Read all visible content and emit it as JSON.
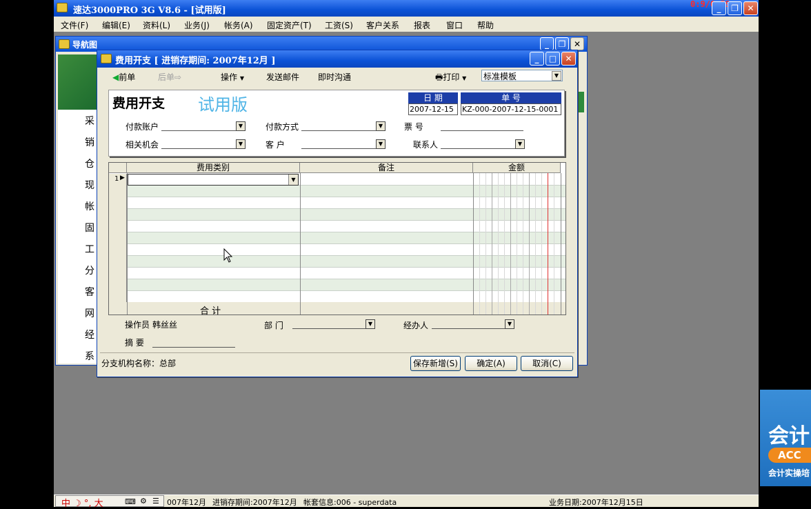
{
  "app": {
    "title": "速达3000PRO 3G V8.6 - [试用版]",
    "timer": "0:9/0:59"
  },
  "menu": [
    "文件(F)",
    "编辑(E)",
    "资料(L)",
    "业务(J)",
    "帐务(A)",
    "固定资产(T)",
    "工资(S)",
    "客户关系",
    "报表",
    "窗口",
    "帮助"
  ],
  "nav": {
    "title": "导航图",
    "items": [
      "采",
      "销",
      "仓",
      "现",
      "帐",
      "固",
      "工",
      "分",
      "客",
      "网",
      "经",
      "系"
    ]
  },
  "dialog": {
    "title": "费用开支 [ 进销存期间: 2007年12月 ]",
    "toolbar": {
      "prev": "前单",
      "next": "后单",
      "operate": "操作",
      "send_mail": "发送邮件",
      "chat": "即时沟通",
      "print": "打印",
      "template": "标准模板"
    },
    "form": {
      "heading": "费用开支",
      "trial": "试用版",
      "date_label": "日  期",
      "date_value": "2007-12-15",
      "no_label": "单  号",
      "no_value": "KZ-000-2007-12-15-0001",
      "pay_account_label": "付款账户",
      "pay_method_label": "付款方式",
      "ticket_label": "票    号",
      "opportunity_label": "相关机会",
      "customer_label": "客    户",
      "contact_label": "联系人"
    },
    "grid": {
      "columns": [
        "费用类别",
        "备注",
        "金额"
      ],
      "first_row_num": "1",
      "total_label": "合  计"
    },
    "footer": {
      "operator_label": "操作员",
      "operator_value": "韩丝丝",
      "dept_label": "部  门",
      "handler_label": "经办人",
      "summary_label": "摘  要",
      "branch": "分支机构名称：总部",
      "save_new": "保存新增(S)",
      "ok": "确定(A)",
      "cancel": "取消(C)"
    }
  },
  "statusbar": {
    "ime": "中 ☽ °, 大",
    "period1": "007年12月",
    "period2": "进销存期间:2007年12月",
    "account": "帐套信息:006 - superdata",
    "business_date": "业务日期:2007年12月15日"
  },
  "ad": {
    "big": "会计",
    "pill": "ACC",
    "small": "会计实操培"
  },
  "colors": {
    "titlebar": "#0b52d6",
    "trial_text": "#4fb4e6",
    "header_box": "#1d3ea8"
  }
}
